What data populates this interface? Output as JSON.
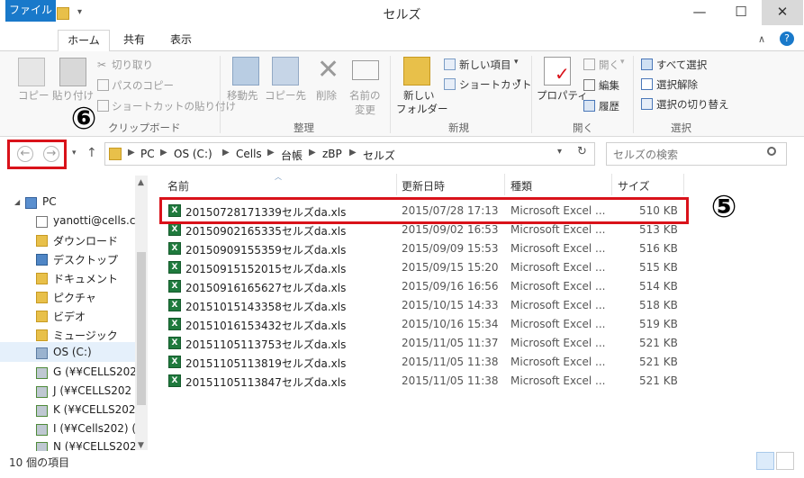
{
  "window": {
    "title": "セルズ",
    "minimize": "—",
    "maximize": "☐",
    "close": "✕"
  },
  "ribbon_tabs": [
    "ファイル",
    "ホーム",
    "共有",
    "表示"
  ],
  "ribbon": {
    "clipboard": {
      "copy": "コピー",
      "paste": "貼り付け",
      "cut": "切り取り",
      "copy_path": "パスのコピー",
      "paste_shortcut": "ショートカットの貼り付け",
      "group": "クリップボード"
    },
    "organize": {
      "move_to": "移動先",
      "copy_to": "コピー先",
      "delete": "削除",
      "rename_line1": "名前の",
      "rename_line2": "変更",
      "group": "整理"
    },
    "new": {
      "new_folder_line1": "新しい",
      "new_folder_line2": "フォルダー",
      "new_item": "新しい項目",
      "shortcut": "ショートカット",
      "group": "新規"
    },
    "open": {
      "properties": "プロパティ",
      "open": "開く",
      "edit": "編集",
      "history": "履歴",
      "group": "開く"
    },
    "select": {
      "select_all": "すべて選択",
      "select_none": "選択解除",
      "invert": "選択の切り替え",
      "group": "選択"
    }
  },
  "address": {
    "crumbs": [
      "PC",
      "OS (C:)",
      "Cells",
      "台帳",
      "zBP",
      "セルズ"
    ],
    "search_placeholder": "セルズの検索"
  },
  "nav_items": [
    {
      "label": "PC",
      "icon": "pc-icon"
    },
    {
      "label": "yanotti@cells.c",
      "icon": "user-icon"
    },
    {
      "label": "ダウンロード",
      "icon": "folder-icon"
    },
    {
      "label": "デスクトップ",
      "icon": "folder-icon"
    },
    {
      "label": "ドキュメント",
      "icon": "folder-icon"
    },
    {
      "label": "ピクチャ",
      "icon": "folder-icon"
    },
    {
      "label": "ビデオ",
      "icon": "folder-icon"
    },
    {
      "label": "ミュージック",
      "icon": "folder-icon"
    },
    {
      "label": "OS (C:)",
      "icon": "drive-icon"
    },
    {
      "label": "G (¥¥CELLS202",
      "icon": "network-drive-icon"
    },
    {
      "label": "J (¥¥CELLS202",
      "icon": "network-drive-icon"
    },
    {
      "label": "K (¥¥CELLS202",
      "icon": "network-drive-icon"
    },
    {
      "label": "I (¥¥Cells202) (",
      "icon": "network-drive-icon"
    },
    {
      "label": "N (¥¥CELLS202",
      "icon": "network-drive-icon"
    }
  ],
  "columns": {
    "name": "名前",
    "modified": "更新日時",
    "type": "種類",
    "size": "サイズ"
  },
  "files": [
    {
      "name": "20150728171339セルズda.xls",
      "date": "2015/07/28 17:13",
      "type": "Microsoft Excel ...",
      "size": "510 KB"
    },
    {
      "name": "20150902165335セルズda.xls",
      "date": "2015/09/02 16:53",
      "type": "Microsoft Excel ...",
      "size": "513 KB"
    },
    {
      "name": "20150909155359セルズda.xls",
      "date": "2015/09/09 15:53",
      "type": "Microsoft Excel ...",
      "size": "516 KB"
    },
    {
      "name": "20150915152015セルズda.xls",
      "date": "2015/09/15 15:20",
      "type": "Microsoft Excel ...",
      "size": "515 KB"
    },
    {
      "name": "20150916165627セルズda.xls",
      "date": "2015/09/16 16:56",
      "type": "Microsoft Excel ...",
      "size": "514 KB"
    },
    {
      "name": "20151015143358セルズda.xls",
      "date": "2015/10/15 14:33",
      "type": "Microsoft Excel ...",
      "size": "518 KB"
    },
    {
      "name": "20151016153432セルズda.xls",
      "date": "2015/10/16 15:34",
      "type": "Microsoft Excel ...",
      "size": "519 KB"
    },
    {
      "name": "20151105113753セルズda.xls",
      "date": "2015/11/05 11:37",
      "type": "Microsoft Excel ...",
      "size": "521 KB"
    },
    {
      "name": "20151105113819セルズda.xls",
      "date": "2015/11/05 11:38",
      "type": "Microsoft Excel ...",
      "size": "521 KB"
    },
    {
      "name": "20151105113847セルズda.xls",
      "date": "2015/11/05 11:38",
      "type": "Microsoft Excel ...",
      "size": "521 KB"
    }
  ],
  "annotations": {
    "five": "⑤",
    "six": "⑥"
  },
  "status": {
    "count": "10 個の項目"
  },
  "colors": {
    "accent": "#1979ca",
    "highlight": "#d9121a",
    "excel": "#1f7a3d"
  }
}
